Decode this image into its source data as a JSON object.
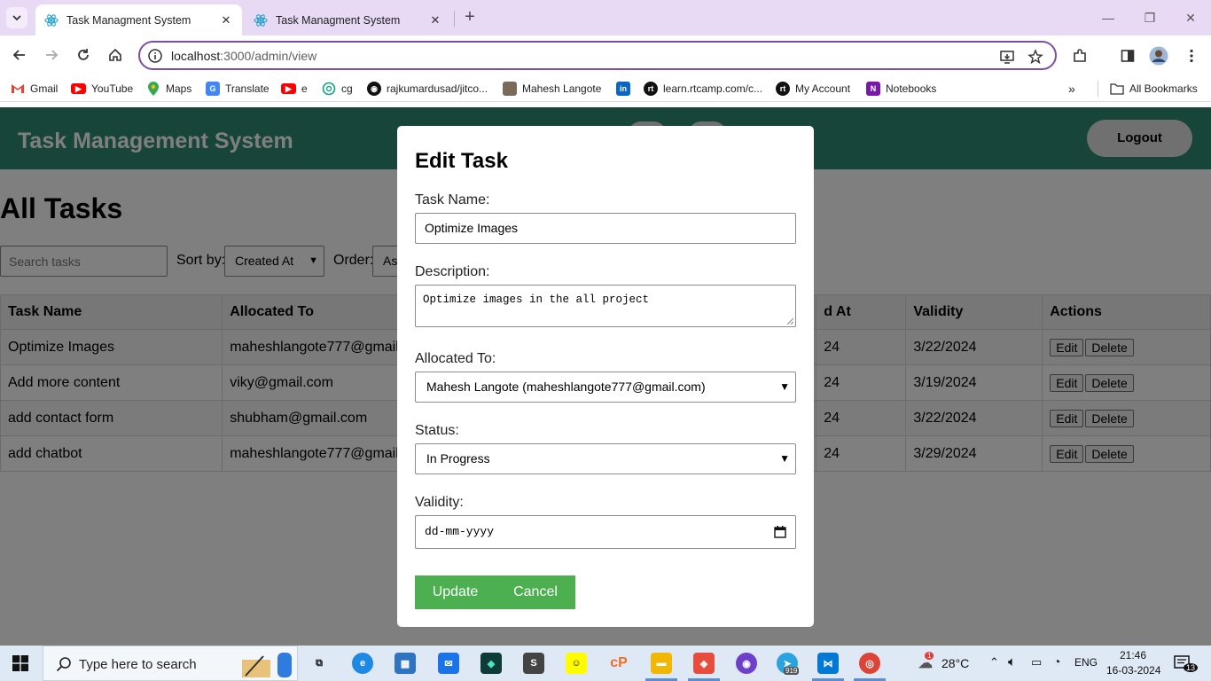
{
  "browser": {
    "tabs": [
      {
        "title": "Task Managment System",
        "active": true
      },
      {
        "title": "Task Managment System",
        "active": false
      }
    ],
    "url_host": "localhost",
    "url_path": ":3000/admin/view",
    "bookmarks": [
      {
        "label": "Gmail",
        "icon": "gmail-icon",
        "color": "#ea4335"
      },
      {
        "label": "YouTube",
        "icon": "youtube-icon",
        "color": "#ff0000"
      },
      {
        "label": "Maps",
        "icon": "maps-icon",
        "color": "#34a853"
      },
      {
        "label": "Translate",
        "icon": "translate-icon",
        "color": "#4285f4"
      },
      {
        "label": "e",
        "icon": "youtube-icon",
        "color": "#ff0000"
      },
      {
        "label": "cg",
        "icon": "chatgpt-icon",
        "color": "#10a37f"
      },
      {
        "label": "rajkumardusad/jitco...",
        "icon": "github-icon",
        "color": "#111111"
      },
      {
        "label": "Mahesh Langote",
        "icon": "avatar-icon",
        "color": "#7a6a5a"
      },
      {
        "label": "",
        "icon": "linkedin-icon",
        "color": "#0a66c2"
      },
      {
        "label": "learn.rtcamp.com/c...",
        "icon": "rtcamp-icon",
        "color": "#111111"
      },
      {
        "label": "My Account",
        "icon": "rtcamp-icon",
        "color": "#111111"
      },
      {
        "label": "Notebooks",
        "icon": "onenote-icon",
        "color": "#7719aa"
      }
    ],
    "all_bookmarks": "All Bookmarks"
  },
  "app": {
    "title": "Task Management System",
    "logout": "Logout",
    "heading": "All Tasks",
    "search_placeholder": "Search tasks",
    "sort_label": "Sort by:",
    "sort_value": "Created At",
    "order_label": "Order:",
    "order_value": "As",
    "columns": [
      "Task Name",
      "Allocated To",
      "d At",
      "Validity",
      "Actions"
    ],
    "rows": [
      {
        "name": "Optimize Images",
        "to": "maheshlangote777@gmail",
        "created": "24",
        "validity": "3/22/2024"
      },
      {
        "name": "Add more content",
        "to": "viky@gmail.com",
        "created": "24",
        "validity": "3/19/2024"
      },
      {
        "name": "add contact form",
        "to": "shubham@gmail.com",
        "created": "24",
        "validity": "3/22/2024"
      },
      {
        "name": "add chatbot",
        "to": "maheshlangote777@gmail",
        "created": "24",
        "validity": "3/29/2024"
      }
    ],
    "edit_label": "Edit",
    "delete_label": "Delete"
  },
  "modal": {
    "title": "Edit Task",
    "task_name_label": "Task Name:",
    "task_name_value": "Optimize Images",
    "description_label": "Description:",
    "description_value": "Optimize images in the all project",
    "allocated_label": "Allocated To:",
    "allocated_value": "Mahesh Langote (maheshlangote777@gmail.com)",
    "status_label": "Status:",
    "status_value": "In Progress",
    "validity_label": "Validity:",
    "validity_value": "dd-mm-yyyy",
    "update": "Update",
    "cancel": "Cancel"
  },
  "taskbar": {
    "search_text": "Type here to search",
    "temperature": "28°C",
    "language": "ENG",
    "time": "21:46",
    "date": "16-03-2024",
    "notification_count": "13",
    "weather_badge": "1",
    "telegram_badge": "919"
  },
  "colors": {
    "header": "#2e8b73",
    "accent_button": "#4caf50",
    "tabstrip": "#e8d9f5",
    "omnibox_border": "#7b4fa0"
  }
}
